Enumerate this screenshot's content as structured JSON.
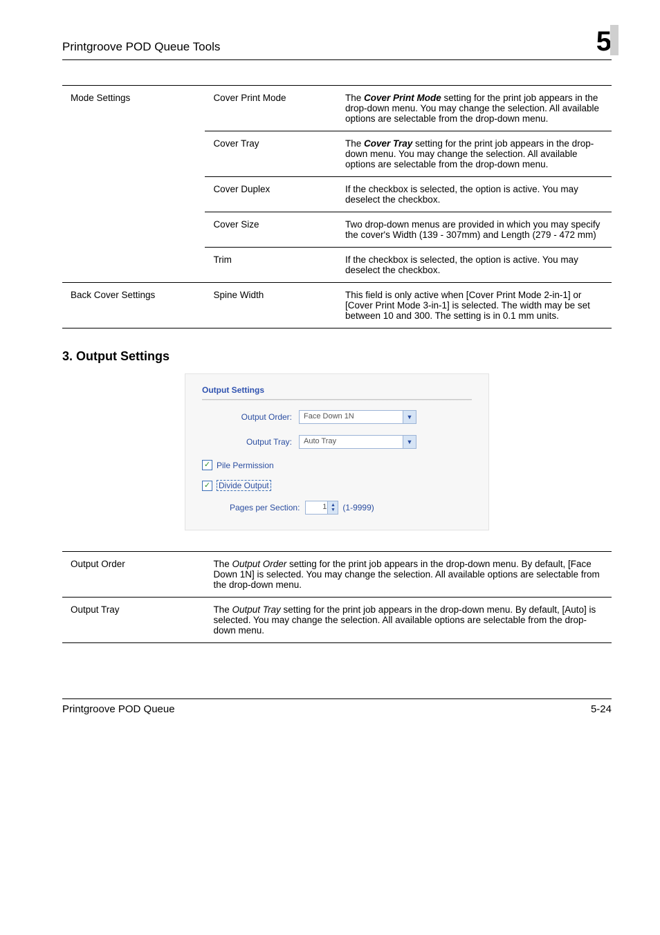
{
  "header": {
    "title": "Printgroove POD Queue Tools",
    "chapter": "5"
  },
  "table1": {
    "rows": [
      {
        "c1": "Mode Settings",
        "c2": "Cover Print Mode",
        "c3_prefix": "The ",
        "c3_bold": "Cover Print Mode",
        "c3_suffix": " setting for the print job appears in the drop-down menu. You may change the selection. All available options are selectable from the drop-down menu."
      },
      {
        "c1": "",
        "c2": "Cover Tray",
        "c3_prefix": "The ",
        "c3_bold": "Cover Tray",
        "c3_suffix": " setting for the print job appears in the drop-down menu. You may change the selection. All available options are selectable from the drop-down menu."
      },
      {
        "c1": "",
        "c2": "Cover Duplex",
        "c3_prefix": "",
        "c3_bold": "",
        "c3_suffix": "If the checkbox is selected, the option is active. You may deselect the checkbox."
      },
      {
        "c1": "",
        "c2": "Cover Size",
        "c3_prefix": "",
        "c3_bold": "",
        "c3_suffix": "Two drop-down menus are provided in which you may specify the cover's Width (139 - 307mm) and Length (279 - 472 mm)"
      },
      {
        "c1": "",
        "c2": "Trim",
        "c3_prefix": "",
        "c3_bold": "",
        "c3_suffix": "If the checkbox is selected, the option is active. You may deselect the checkbox."
      },
      {
        "c1": "Back Cover Settings",
        "c2": "Spine Width",
        "c3_prefix": "",
        "c3_bold": "",
        "c3_suffix": "This field is only active when [Cover Print Mode 2-in-1] or [Cover Print Mode 3-in-1] is selected. The width may be set between 10 and 300. The setting is in 0.1 mm units."
      }
    ]
  },
  "section_heading": "3. Output Settings",
  "panel": {
    "title": "Output Settings",
    "order_label": "Output Order:",
    "order_value": "Face Down 1N",
    "tray_label": "Output Tray:",
    "tray_value": "Auto Tray",
    "pile_label": "Pile Permission",
    "divide_label": "Divide Output",
    "pps_label": "Pages per Section:",
    "pps_value": "1",
    "pps_range": "(1-9999)"
  },
  "table2": {
    "rows": [
      {
        "l": "Output Order",
        "r_prefix": "The ",
        "r_bold": "Output Order",
        "r_suffix": " setting for the print job appears in the drop-down menu. By default, [Face Down 1N] is selected. You may change the selection. All available options are selectable from the drop-down menu."
      },
      {
        "l": "Output Tray",
        "r_prefix": "The ",
        "r_bold": "Output Tray",
        "r_suffix": " setting for the print job appears in the drop-down menu. By default, [Auto] is selected. You may change the selection. All available options are selectable from the drop-down menu."
      }
    ]
  },
  "footer": {
    "left": "Printgroove POD Queue",
    "right": "5-24"
  }
}
